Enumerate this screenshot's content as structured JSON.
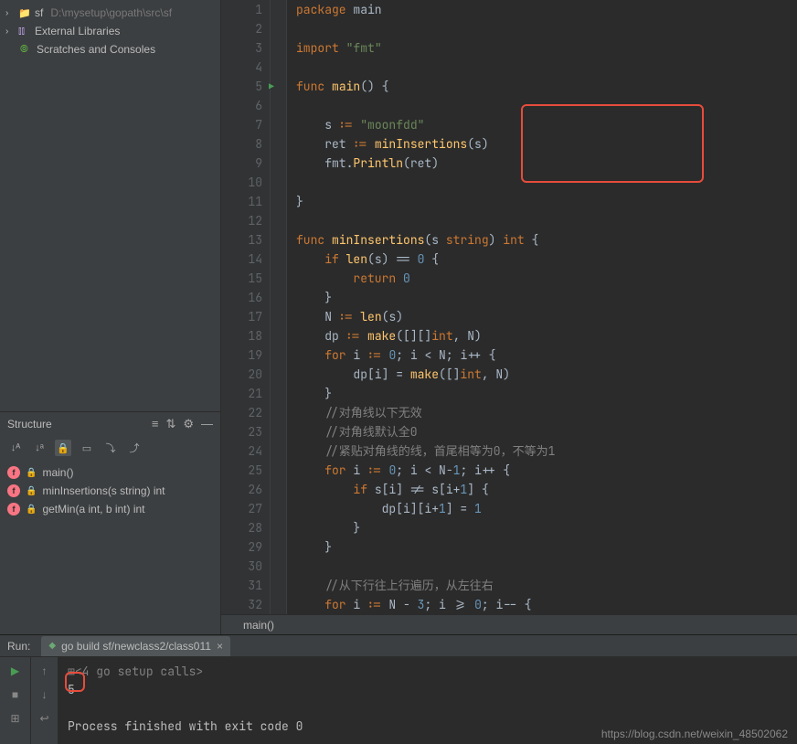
{
  "project": {
    "root": {
      "name": "sf",
      "path": "D:\\mysetup\\gopath\\src\\sf"
    },
    "externalLibs": "External Libraries",
    "scratches": "Scratches and Consoles"
  },
  "structure": {
    "title": "Structure",
    "items": [
      {
        "name": "main()"
      },
      {
        "name": "minInsertions(s string) int"
      },
      {
        "name": "getMin(a int, b int) int"
      }
    ]
  },
  "editor": {
    "breadcrumb": "main()",
    "lines": [
      {
        "n": 1,
        "tokens": [
          [
            "kw",
            "package"
          ],
          [
            "ident",
            " main"
          ]
        ]
      },
      {
        "n": 2,
        "tokens": []
      },
      {
        "n": 3,
        "tokens": [
          [
            "kw",
            "import"
          ],
          [
            "ident",
            " "
          ],
          [
            "str",
            "\"fmt\""
          ]
        ]
      },
      {
        "n": 4,
        "tokens": []
      },
      {
        "n": 5,
        "tokens": [
          [
            "kw",
            "func"
          ],
          [
            "ident",
            " "
          ],
          [
            "fn",
            "main"
          ],
          [
            "par",
            "() {"
          ]
        ],
        "run": true
      },
      {
        "n": 6,
        "tokens": []
      },
      {
        "n": 7,
        "tokens": [
          [
            "ident",
            "    s "
          ],
          [
            "kw",
            ":="
          ],
          [
            "ident",
            " "
          ],
          [
            "str",
            "\"moonfdd\""
          ]
        ]
      },
      {
        "n": 8,
        "tokens": [
          [
            "ident",
            "    ret "
          ],
          [
            "kw",
            ":="
          ],
          [
            "ident",
            " "
          ],
          [
            "fn",
            "minInsertions"
          ],
          [
            "par",
            "("
          ],
          [
            "ident",
            "s"
          ],
          [
            "par",
            ")"
          ]
        ]
      },
      {
        "n": 9,
        "tokens": [
          [
            "ident",
            "    fmt."
          ],
          [
            "fn",
            "Println"
          ],
          [
            "par",
            "("
          ],
          [
            "ident",
            "ret"
          ],
          [
            "par",
            ")"
          ]
        ]
      },
      {
        "n": 10,
        "tokens": []
      },
      {
        "n": 11,
        "tokens": [
          [
            "par",
            "}"
          ]
        ]
      },
      {
        "n": 12,
        "tokens": []
      },
      {
        "n": 13,
        "tokens": [
          [
            "kw",
            "func"
          ],
          [
            "ident",
            " "
          ],
          [
            "fn",
            "minInsertions"
          ],
          [
            "par",
            "("
          ],
          [
            "ident",
            "s "
          ],
          [
            "typ",
            "string"
          ],
          [
            "par",
            ") "
          ],
          [
            "typ",
            "int"
          ],
          [
            "par",
            " {"
          ]
        ]
      },
      {
        "n": 14,
        "tokens": [
          [
            "ident",
            "    "
          ],
          [
            "kw",
            "if"
          ],
          [
            "ident",
            " "
          ],
          [
            "fn",
            "len"
          ],
          [
            "par",
            "("
          ],
          [
            "ident",
            "s"
          ],
          [
            "par",
            ") == "
          ],
          [
            "num",
            "0"
          ],
          [
            "par",
            " {"
          ]
        ]
      },
      {
        "n": 15,
        "tokens": [
          [
            "ident",
            "        "
          ],
          [
            "kw",
            "return"
          ],
          [
            "ident",
            " "
          ],
          [
            "num",
            "0"
          ]
        ]
      },
      {
        "n": 16,
        "tokens": [
          [
            "ident",
            "    "
          ],
          [
            "par",
            "}"
          ]
        ]
      },
      {
        "n": 17,
        "tokens": [
          [
            "ident",
            "    N "
          ],
          [
            "kw",
            ":="
          ],
          [
            "ident",
            " "
          ],
          [
            "fn",
            "len"
          ],
          [
            "par",
            "("
          ],
          [
            "ident",
            "s"
          ],
          [
            "par",
            ")"
          ]
        ]
      },
      {
        "n": 18,
        "tokens": [
          [
            "ident",
            "    dp "
          ],
          [
            "kw",
            ":="
          ],
          [
            "ident",
            " "
          ],
          [
            "fn",
            "make"
          ],
          [
            "par",
            "([][]"
          ],
          [
            "typ",
            "int"
          ],
          [
            "par",
            ", N)"
          ]
        ]
      },
      {
        "n": 19,
        "tokens": [
          [
            "ident",
            "    "
          ],
          [
            "kw",
            "for"
          ],
          [
            "ident",
            " i "
          ],
          [
            "kw",
            ":="
          ],
          [
            "ident",
            " "
          ],
          [
            "num",
            "0"
          ],
          [
            "ident",
            "; i < N; i++ {"
          ]
        ]
      },
      {
        "n": 20,
        "tokens": [
          [
            "ident",
            "        dp[i] = "
          ],
          [
            "fn",
            "make"
          ],
          [
            "par",
            "([]"
          ],
          [
            "typ",
            "int"
          ],
          [
            "par",
            ", N)"
          ]
        ]
      },
      {
        "n": 21,
        "tokens": [
          [
            "ident",
            "    "
          ],
          [
            "par",
            "}"
          ]
        ]
      },
      {
        "n": 22,
        "tokens": [
          [
            "ident",
            "    "
          ],
          [
            "comm",
            "//对角线以下无效"
          ]
        ]
      },
      {
        "n": 23,
        "tokens": [
          [
            "ident",
            "    "
          ],
          [
            "comm",
            "//对角线默认全0"
          ]
        ]
      },
      {
        "n": 24,
        "tokens": [
          [
            "ident",
            "    "
          ],
          [
            "comm",
            "//紧贴对角线的线，首尾相等为0，不等为1"
          ]
        ]
      },
      {
        "n": 25,
        "tokens": [
          [
            "ident",
            "    "
          ],
          [
            "kw",
            "for"
          ],
          [
            "ident",
            " i "
          ],
          [
            "kw",
            ":="
          ],
          [
            "ident",
            " "
          ],
          [
            "num",
            "0"
          ],
          [
            "ident",
            "; i < N-"
          ],
          [
            "num",
            "1"
          ],
          [
            "ident",
            "; i++ {"
          ]
        ]
      },
      {
        "n": 26,
        "tokens": [
          [
            "ident",
            "        "
          ],
          [
            "kw",
            "if"
          ],
          [
            "ident",
            " s[i] != s[i+"
          ],
          [
            "num",
            "1"
          ],
          [
            "ident",
            "] {"
          ]
        ]
      },
      {
        "n": 27,
        "tokens": [
          [
            "ident",
            "            dp[i][i+"
          ],
          [
            "num",
            "1"
          ],
          [
            "ident",
            "] = "
          ],
          [
            "num",
            "1"
          ]
        ]
      },
      {
        "n": 28,
        "tokens": [
          [
            "ident",
            "        "
          ],
          [
            "par",
            "}"
          ]
        ]
      },
      {
        "n": 29,
        "tokens": [
          [
            "ident",
            "    "
          ],
          [
            "par",
            "}"
          ]
        ]
      },
      {
        "n": 30,
        "tokens": []
      },
      {
        "n": 31,
        "tokens": [
          [
            "ident",
            "    "
          ],
          [
            "comm",
            "//从下行往上行遍历，从左往右"
          ]
        ]
      },
      {
        "n": 32,
        "tokens": [
          [
            "ident",
            "    "
          ],
          [
            "kw",
            "for"
          ],
          [
            "ident",
            " i "
          ],
          [
            "kw",
            ":="
          ],
          [
            "ident",
            " N - "
          ],
          [
            "num",
            "3"
          ],
          [
            "ident",
            "; i >= "
          ],
          [
            "num",
            "0"
          ],
          [
            "ident",
            "; i-- {"
          ]
        ]
      }
    ]
  },
  "run": {
    "label": "Run:",
    "tabName": "go build sf/newclass2/class011",
    "console": [
      {
        "text": "<4 go setup calls>",
        "dim": true,
        "prefix": "⊞"
      },
      {
        "text": "5"
      },
      {
        "text": ""
      },
      {
        "text": "Process finished with exit code 0"
      }
    ]
  },
  "watermark": "https://blog.csdn.net/weixin_48502062"
}
